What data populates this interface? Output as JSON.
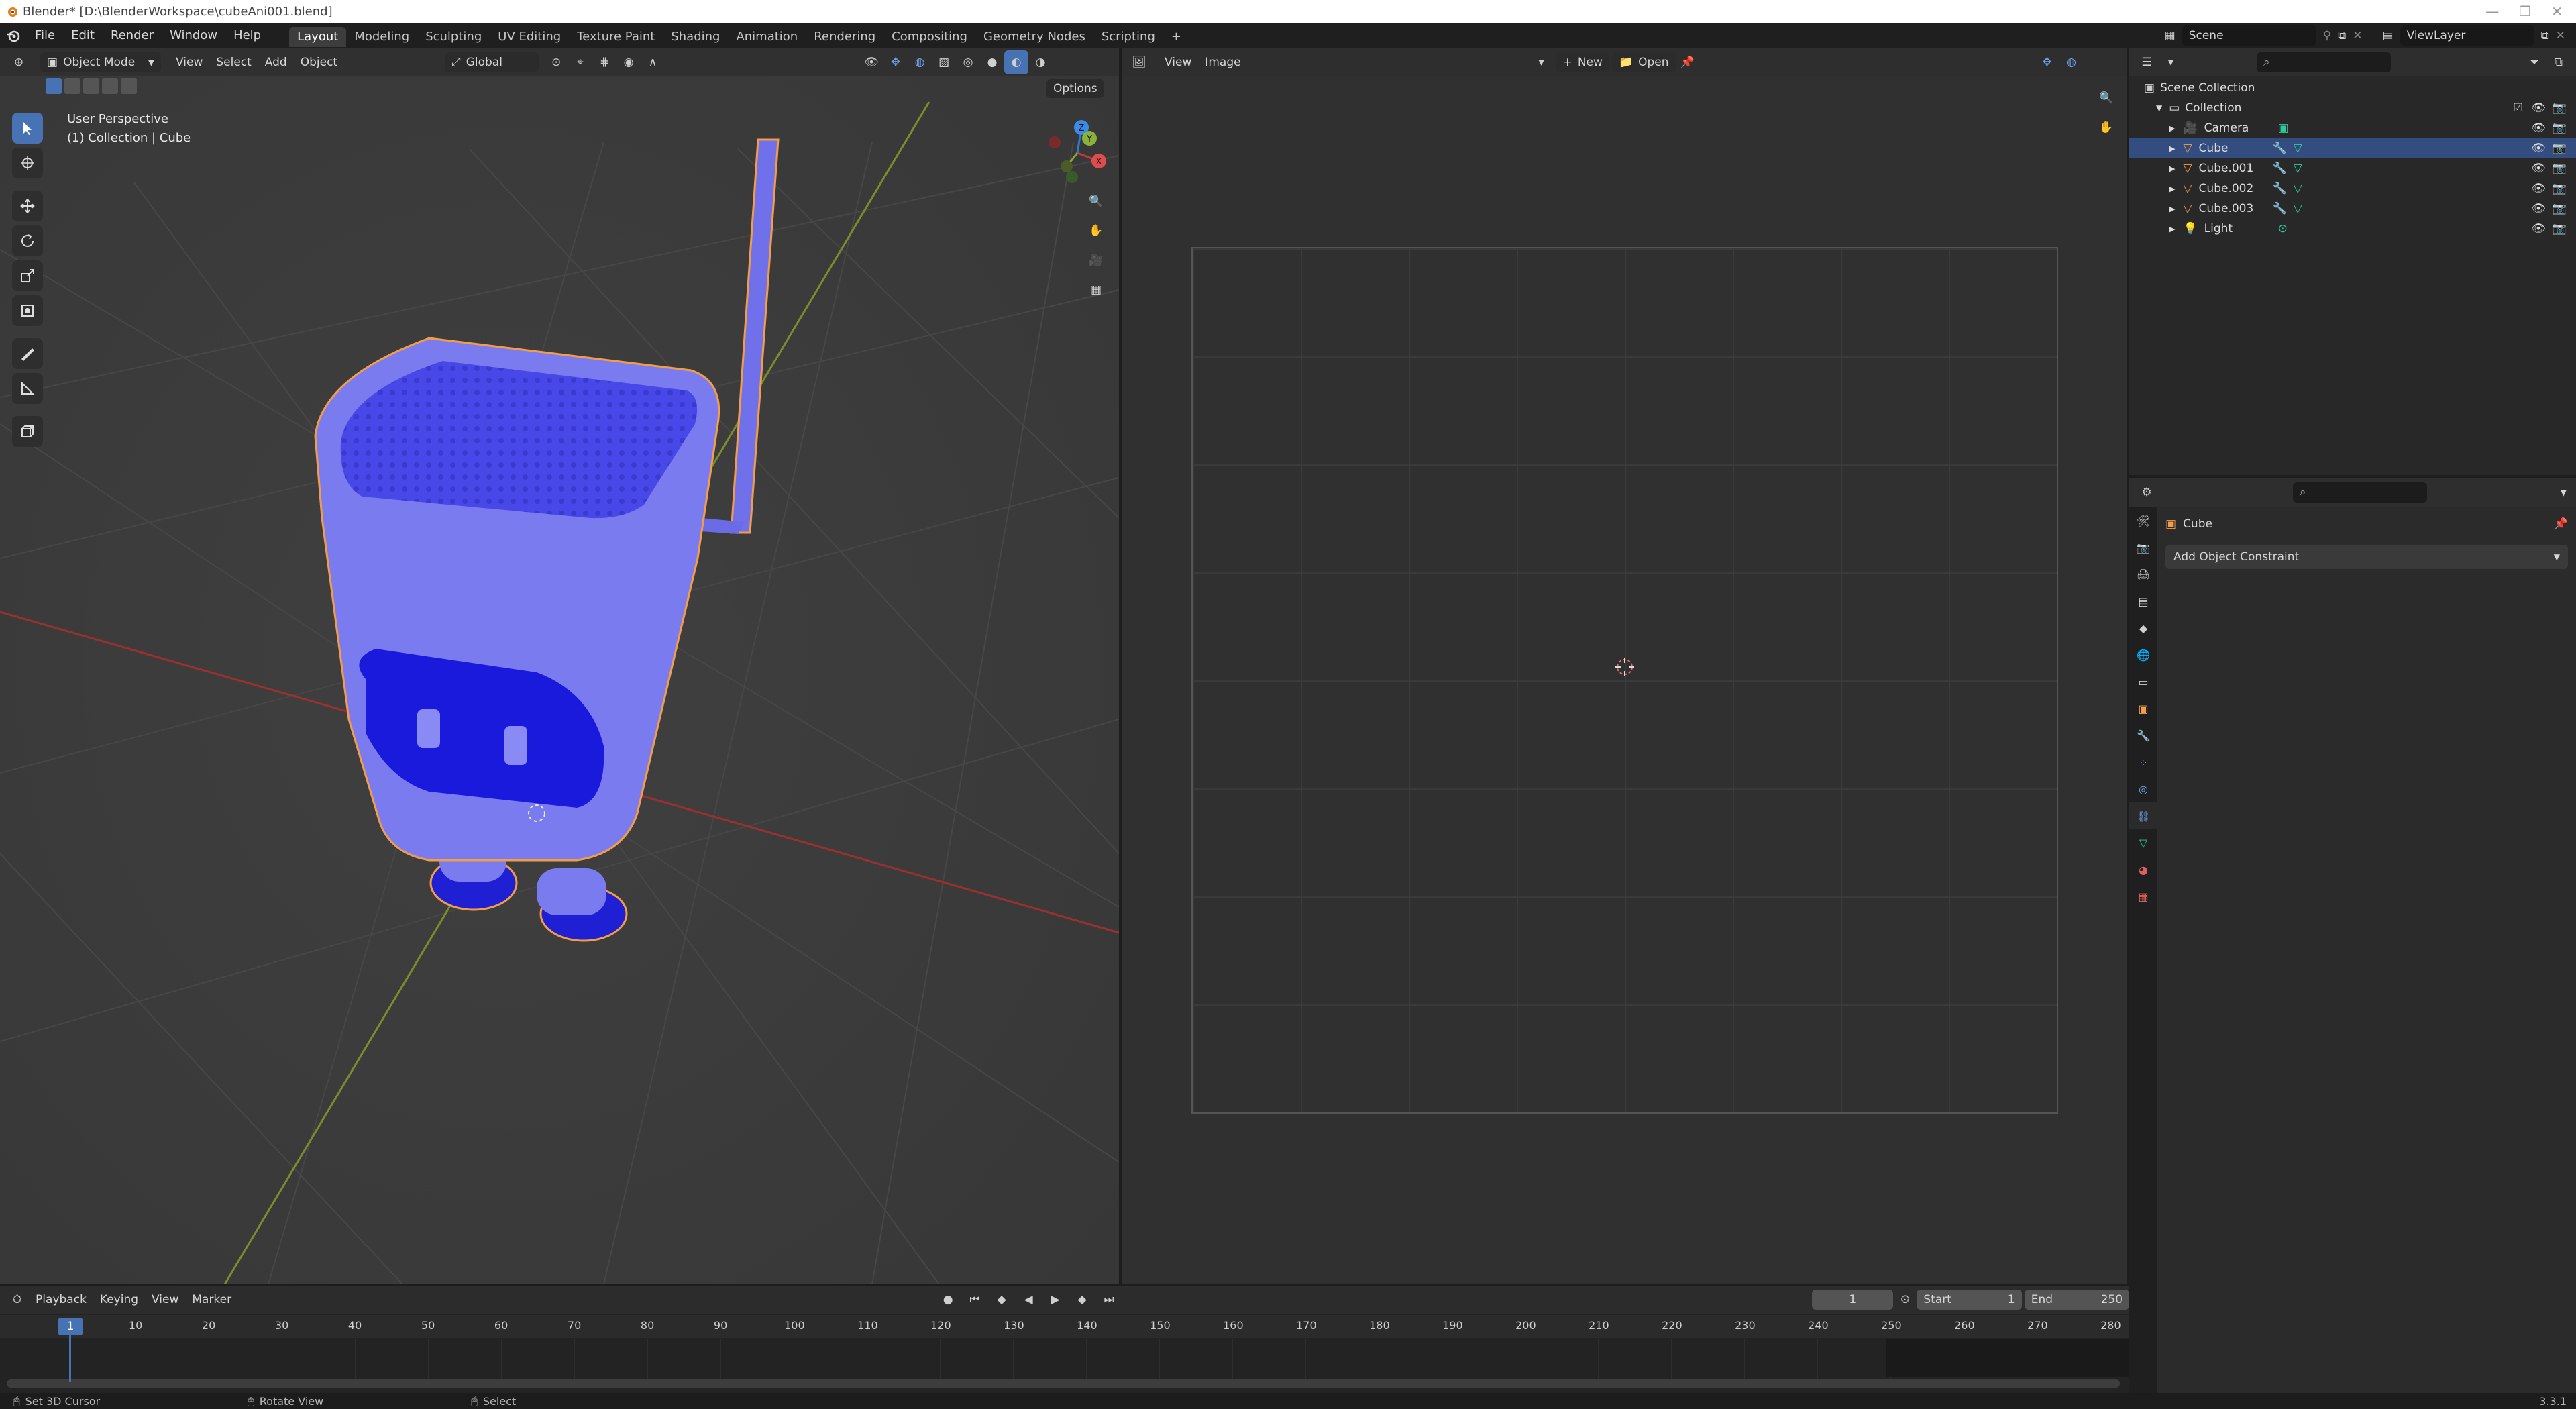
{
  "window": {
    "title": "Blender* [D:\\BlenderWorkspace\\cubeAni001.blend]"
  },
  "topbar": {
    "menus": [
      "File",
      "Edit",
      "Render",
      "Window",
      "Help"
    ],
    "workspaces": [
      "Layout",
      "Modeling",
      "Sculpting",
      "UV Editing",
      "Texture Paint",
      "Shading",
      "Animation",
      "Rendering",
      "Compositing",
      "Geometry Nodes",
      "Scripting"
    ],
    "active_workspace": "Layout",
    "add_tab": "+",
    "scene": "Scene",
    "view_layer": "ViewLayer"
  },
  "viewport": {
    "mode": "Object Mode",
    "menus": [
      "View",
      "Select",
      "Add",
      "Object"
    ],
    "transform_orientation": "Global",
    "options_label": "Options",
    "overlay_line1": "User Perspective",
    "overlay_line2": "(1) Collection | Cube",
    "gizmo_axes": {
      "x": "X",
      "y": "Y",
      "z": "Z"
    },
    "colors": {
      "object": "#7b7bf0",
      "selection_outline": "#f29d49",
      "x_axis": "#c0393b",
      "y_axis": "#8aa832"
    }
  },
  "image_editor": {
    "menus": [
      "View",
      "Image"
    ],
    "new_label": "New",
    "open_label": "Open"
  },
  "outliner": {
    "root": "Scene Collection",
    "collection": "Collection",
    "items": [
      {
        "name": "Camera",
        "type": "camera",
        "selected": false
      },
      {
        "name": "Cube",
        "type": "mesh",
        "selected": true
      },
      {
        "name": "Cube.001",
        "type": "mesh",
        "selected": false
      },
      {
        "name": "Cube.002",
        "type": "mesh",
        "selected": false
      },
      {
        "name": "Cube.003",
        "type": "mesh",
        "selected": false
      },
      {
        "name": "Light",
        "type": "light",
        "selected": false
      }
    ]
  },
  "properties": {
    "object_name": "Cube",
    "add_constraint_label": "Add Object Constraint",
    "tab_icons": [
      "tool-icon",
      "render-icon",
      "output-icon",
      "view-layer-icon",
      "scene-icon",
      "world-icon",
      "collection-icon",
      "object-icon",
      "modifier-icon",
      "particles-icon",
      "physics-icon",
      "constraints-icon",
      "data-icon",
      "material-icon",
      "texture-icon"
    ]
  },
  "timeline": {
    "menus": [
      "Playback",
      "Keying",
      "View",
      "Marker"
    ],
    "current_frame": "1",
    "start_label": "Start",
    "start_value": "1",
    "end_label": "End",
    "end_value": "250",
    "ticks": [
      "1",
      "10",
      "20",
      "30",
      "40",
      "50",
      "60",
      "70",
      "80",
      "90",
      "100",
      "110",
      "120",
      "130",
      "140",
      "150",
      "160",
      "170",
      "180",
      "190",
      "200",
      "210",
      "220",
      "230",
      "240",
      "250",
      "260",
      "270",
      "280"
    ]
  },
  "statusbar": {
    "hints": [
      "Set 3D Cursor",
      "Rotate View",
      "Select"
    ],
    "version": "3.3.1"
  }
}
